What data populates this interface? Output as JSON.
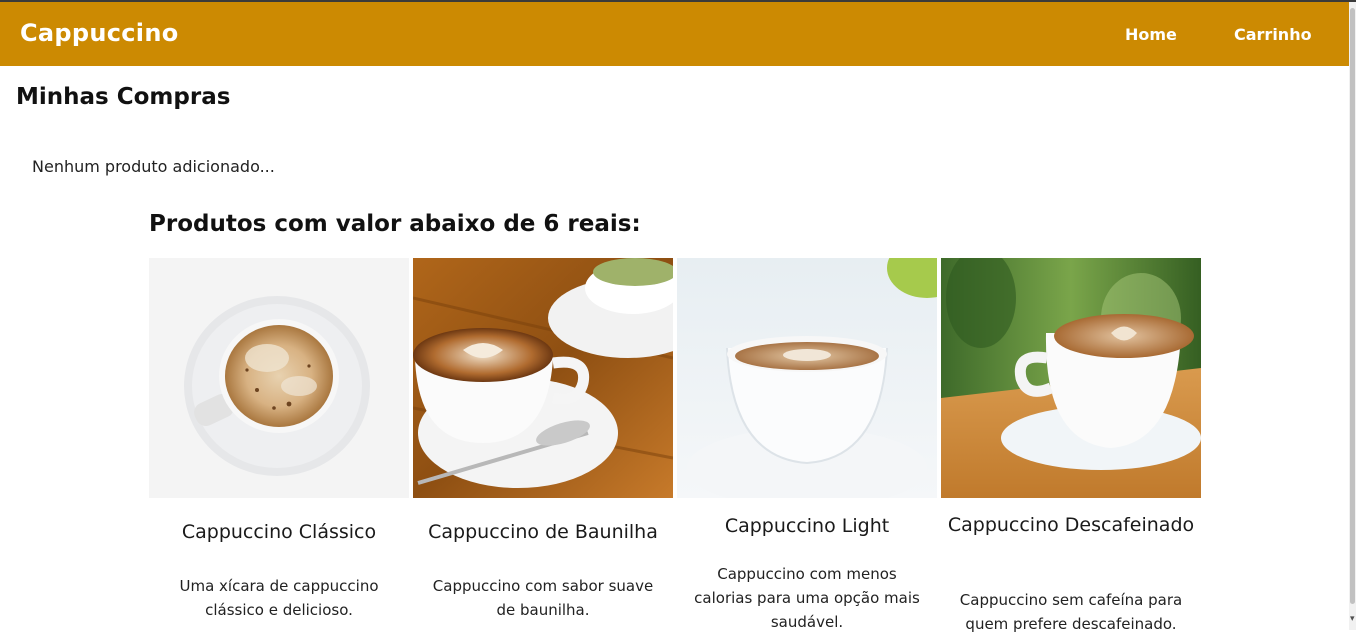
{
  "navbar": {
    "brand": "Cappuccino",
    "links": [
      "Home",
      "Carrinho"
    ],
    "bg_color": "#cc8a02"
  },
  "main": {
    "title": "Minhas Compras",
    "empty_message": "Nenhum produto adicionado...",
    "section_title": "Produtos com valor abaixo de 6 reais:"
  },
  "products": [
    {
      "name": "Cappuccino Clássico",
      "description": "Uma xícara de cappuccino clássico e delicioso.",
      "image": "cappuccino-top-view-photo"
    },
    {
      "name": "Cappuccino de Baunilha",
      "description": "Cappuccino com sabor suave de baunilha.",
      "image": "latte-art-heart-photo"
    },
    {
      "name": "Cappuccino Light",
      "description": "Cappuccino com menos calorias para uma opção mais saudável.",
      "image": "white-cup-cappuccino-photo"
    },
    {
      "name": "Cappuccino Descafeinado",
      "description": "Cappuccino sem cafeína para quem prefere descafeinado.",
      "image": "cappuccino-on-wood-table-photo"
    }
  ]
}
